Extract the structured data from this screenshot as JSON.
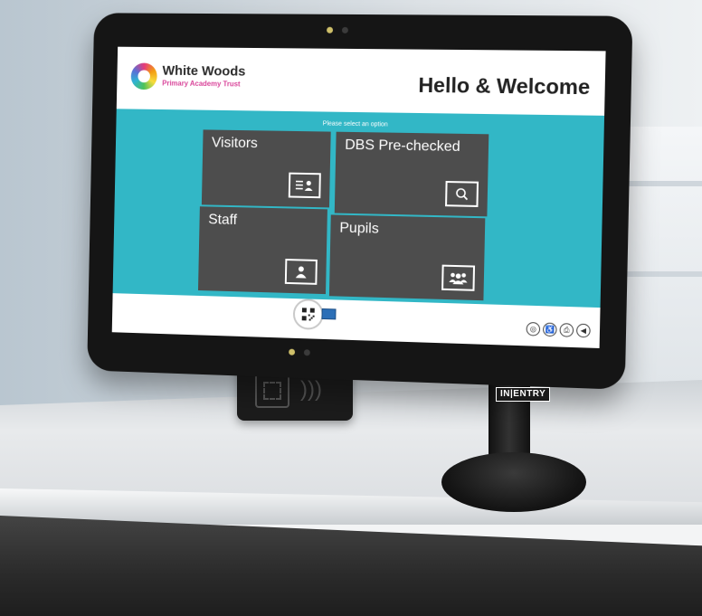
{
  "header": {
    "org_name": "White Woods",
    "org_subtitle": "Primary Academy Trust",
    "welcome": "Hello & Welcome"
  },
  "main": {
    "prompt": "Please select an option",
    "tiles": [
      {
        "label": "Visitors",
        "icon": "id-card-icon"
      },
      {
        "label": "DBS Pre-checked",
        "icon": "search-icon"
      },
      {
        "label": "Staff",
        "icon": "person-badge-icon"
      },
      {
        "label": "Pupils",
        "icon": "group-icon"
      }
    ]
  },
  "footer": {
    "scan_icon": "qr-code-icon",
    "nfc_icon": "nfc-card-icon",
    "tray_icons": [
      "globe-icon",
      "accessibility-icon",
      "printer-icon",
      "volume-icon"
    ]
  },
  "device": {
    "brand": "IN|ENTRY"
  },
  "colors": {
    "teal": "#32b7c6",
    "tile": "#4d4d4d",
    "accent_pink": "#d9459a"
  }
}
